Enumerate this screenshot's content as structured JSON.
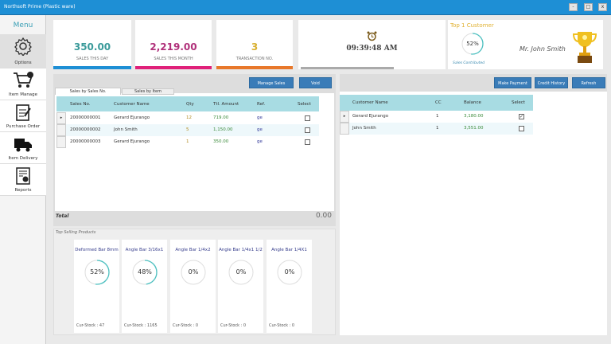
{
  "window": {
    "title": "Northsoft Prime (Plastic ware)",
    "minimize": "-",
    "maximize": "□",
    "close": "x"
  },
  "sidebar": {
    "title": "Menu",
    "items": [
      {
        "label": "Options",
        "icon": "gear-icon"
      },
      {
        "label": "Item Manage",
        "icon": "cart-icon"
      },
      {
        "label": "Purchase Order",
        "icon": "clipboard-icon"
      },
      {
        "label": "Item Delivery",
        "icon": "truck-icon"
      },
      {
        "label": "Reports",
        "icon": "report-icon"
      }
    ]
  },
  "stats": [
    {
      "value": "350.00",
      "caption": "SALES THIS DAY",
      "color": "#3a9a9a",
      "bar": "#1e8fd5"
    },
    {
      "value": "2,219.00",
      "caption": "SALES THIS MONTH",
      "color": "#b0307a",
      "bar": "#e0207a"
    },
    {
      "value": "3",
      "caption": "TRANSACTION NO.",
      "color": "#d8b030",
      "bar": "#e8782a"
    }
  ],
  "clock": {
    "time": "09:39:48 AM"
  },
  "top_customer": {
    "title": "Top 1 Customer",
    "percent": "52%",
    "percent_value": 52,
    "caption": "Sales Contributed",
    "name": "Mr. John Smith"
  },
  "sales": {
    "buttons": {
      "manage": "Manage Sales",
      "void": "Void"
    },
    "tabs": [
      "Sales by Sales No.",
      "Sales by Item"
    ],
    "columns": [
      "Sales No.",
      "Customer Name",
      "Qty",
      "Ttl. Amount",
      "Ref.",
      "Select"
    ],
    "rows": [
      {
        "no": "20000000001",
        "customer": "Gerard Ejurango",
        "qty": "12",
        "amount": "719.00",
        "ref": "ge",
        "selected": false
      },
      {
        "no": "20000000002",
        "customer": "John Smith",
        "qty": "5",
        "amount": "1,150.00",
        "ref": "ge",
        "selected": false
      },
      {
        "no": "20000000003",
        "customer": "Gerard Ejurango",
        "qty": "1",
        "amount": "350.00",
        "ref": "ge",
        "selected": false
      }
    ],
    "total_label": "Total",
    "total": "0.00"
  },
  "top_products": {
    "title": "Top Selling Products",
    "items": [
      {
        "name": "Deformed Bar 8mm",
        "percent": "52%",
        "value": 52,
        "stock": "Cur-Stock : 47"
      },
      {
        "name": "Angle Bar 3/16x1",
        "percent": "48%",
        "value": 48,
        "stock": "Cur-Stock : 1165"
      },
      {
        "name": "Angle Bar 1/4x2",
        "percent": "0%",
        "value": 0,
        "stock": "Cur-Stock : 0"
      },
      {
        "name": "Angle Bar 1/4x1 1/2",
        "percent": "0%",
        "value": 0,
        "stock": "Cur-Stock : 0"
      },
      {
        "name": "Angle Bar 1/4X1",
        "percent": "0%",
        "value": 0,
        "stock": "Cur-Stock : 0"
      }
    ]
  },
  "credit": {
    "buttons": {
      "payment": "Make Payment",
      "history": "Credit History",
      "refresh": "Refresh"
    },
    "columns": [
      "Customer Name",
      "CC",
      "Balance",
      "Select"
    ],
    "rows": [
      {
        "customer": "Gerard Ejurango",
        "cc": "1",
        "balance": "3,180.00",
        "selected": true
      },
      {
        "customer": "John Smith",
        "cc": "1",
        "balance": "3,551.00",
        "selected": false
      }
    ]
  }
}
